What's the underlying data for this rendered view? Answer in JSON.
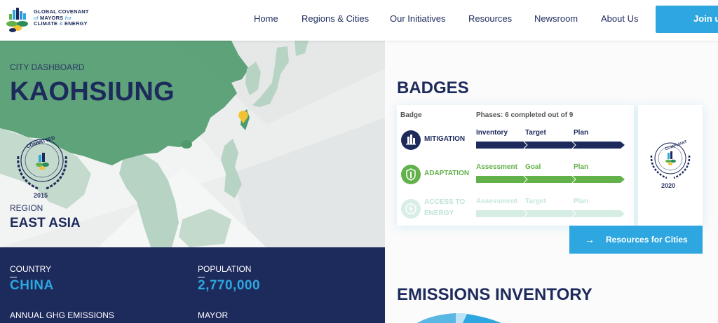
{
  "logo": {
    "line1": "GLOBAL COVENANT",
    "line2_a": "of",
    "line2_b": "MAYORS",
    "line2_c": "for",
    "line3_a": "CLIMATE",
    "line3_b": "&",
    "line3_c": "ENERGY"
  },
  "nav": {
    "items": [
      "Home",
      "Regions & Cities",
      "Our Initiatives",
      "Resources",
      "Newsroom",
      "About Us"
    ],
    "join_label": "Join us"
  },
  "hero": {
    "kicker": "CITY DASHBOARD",
    "city": "KAOHSIUNG",
    "region_label": "REGION",
    "region": "EAST ASIA",
    "committed_badge": {
      "word": "COMMITTED",
      "year": "2015"
    }
  },
  "stats": {
    "country_label": "COUNTRY",
    "country": "CHINA",
    "population_label": "POPULATION",
    "population": "2,770,000",
    "ghg_label": "ANNUAL GHG EMISSIONS",
    "mayor_label": "MAYOR"
  },
  "badges": {
    "title": "BADGES",
    "col_badge": "Badge",
    "col_phases": "Phases: 6 completed out of 9",
    "rows": [
      {
        "name": "MITIGATION",
        "phases": [
          "Inventory",
          "Target",
          "Plan"
        ],
        "color": "#1d2a5c",
        "completed": 3
      },
      {
        "name": "ADAPTATION",
        "phases": [
          "Assessment",
          "Goal",
          "Plan"
        ],
        "color": "#63b14a",
        "completed": 3
      },
      {
        "name_1": "ACCESS TO",
        "name_2": "ENERGY",
        "phases": [
          "Assessment",
          "Target",
          "Plan"
        ],
        "color": "#cfe9e0",
        "completed": 0
      }
    ],
    "compliant_badge": {
      "word": "COMPLIANT",
      "year": "2020"
    }
  },
  "resources_button": {
    "arrow": "→",
    "label": "Resources for Cities"
  },
  "emissions": {
    "title": "EMISSIONS INVENTORY"
  },
  "colors": {
    "navy": "#1d2a5c",
    "blue": "#2ea7e0",
    "green": "#63b14a",
    "land": "#4f9a6d"
  }
}
